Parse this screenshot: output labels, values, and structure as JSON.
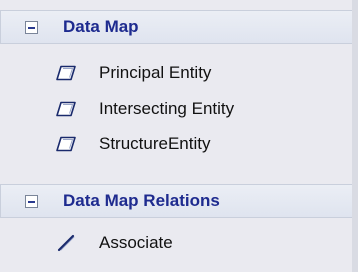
{
  "groups": [
    {
      "title": "Data Map",
      "items": [
        {
          "label": "Principal Entity",
          "icon": "entity-icon"
        },
        {
          "label": "Intersecting Entity",
          "icon": "entity-icon"
        },
        {
          "label": "StructureEntity",
          "icon": "entity-icon"
        }
      ]
    },
    {
      "title": "Data Map Relations",
      "items": [
        {
          "label": "Associate",
          "icon": "associate-line-icon"
        }
      ]
    }
  ],
  "colors": {
    "header_text": "#1e2b8f",
    "panel_bg": "#eaeaf0",
    "header_bg": "#dfe4ef",
    "icon_stroke": "#1a2a6c"
  }
}
